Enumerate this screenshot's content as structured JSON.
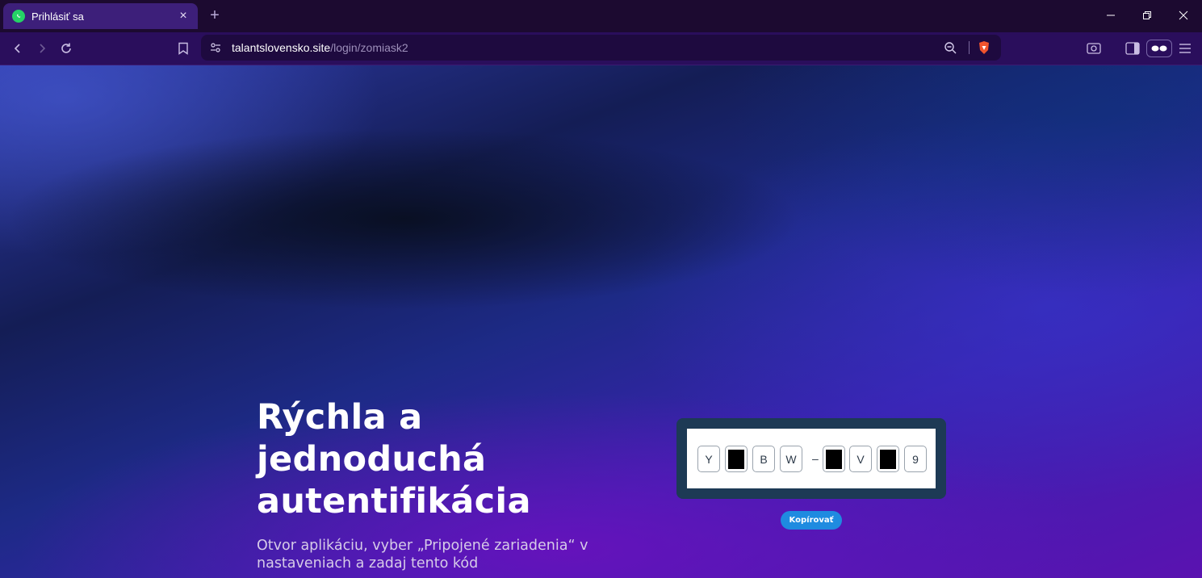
{
  "browser": {
    "tab": {
      "title": "Prihlásiť sa",
      "favicon": "whatsapp-icon"
    },
    "url": {
      "host": "talantslovensko.site",
      "path": "/login/zomiask2"
    },
    "accent": "#2a0e5c"
  },
  "page": {
    "headline": "Rýchla a jednoduchá autentifikácia",
    "subtext": "Otvor aplikáciu, vyber „Pripojené zariadenia“ v nastaveniach a zadaj tento kód",
    "code": {
      "slots": [
        {
          "char": "Y",
          "masked": false
        },
        {
          "char": "",
          "masked": true
        },
        {
          "char": "B",
          "masked": false
        },
        {
          "char": "W",
          "masked": false
        },
        {
          "char": "",
          "masked": true
        },
        {
          "char": "V",
          "masked": false
        },
        {
          "char": "",
          "masked": true
        },
        {
          "char": "9",
          "masked": false
        }
      ],
      "separator": "–"
    },
    "copy_button": "Kopírovať",
    "colors": {
      "copy_button": "#1f8be0",
      "code_frame": "#1d3a55"
    }
  }
}
